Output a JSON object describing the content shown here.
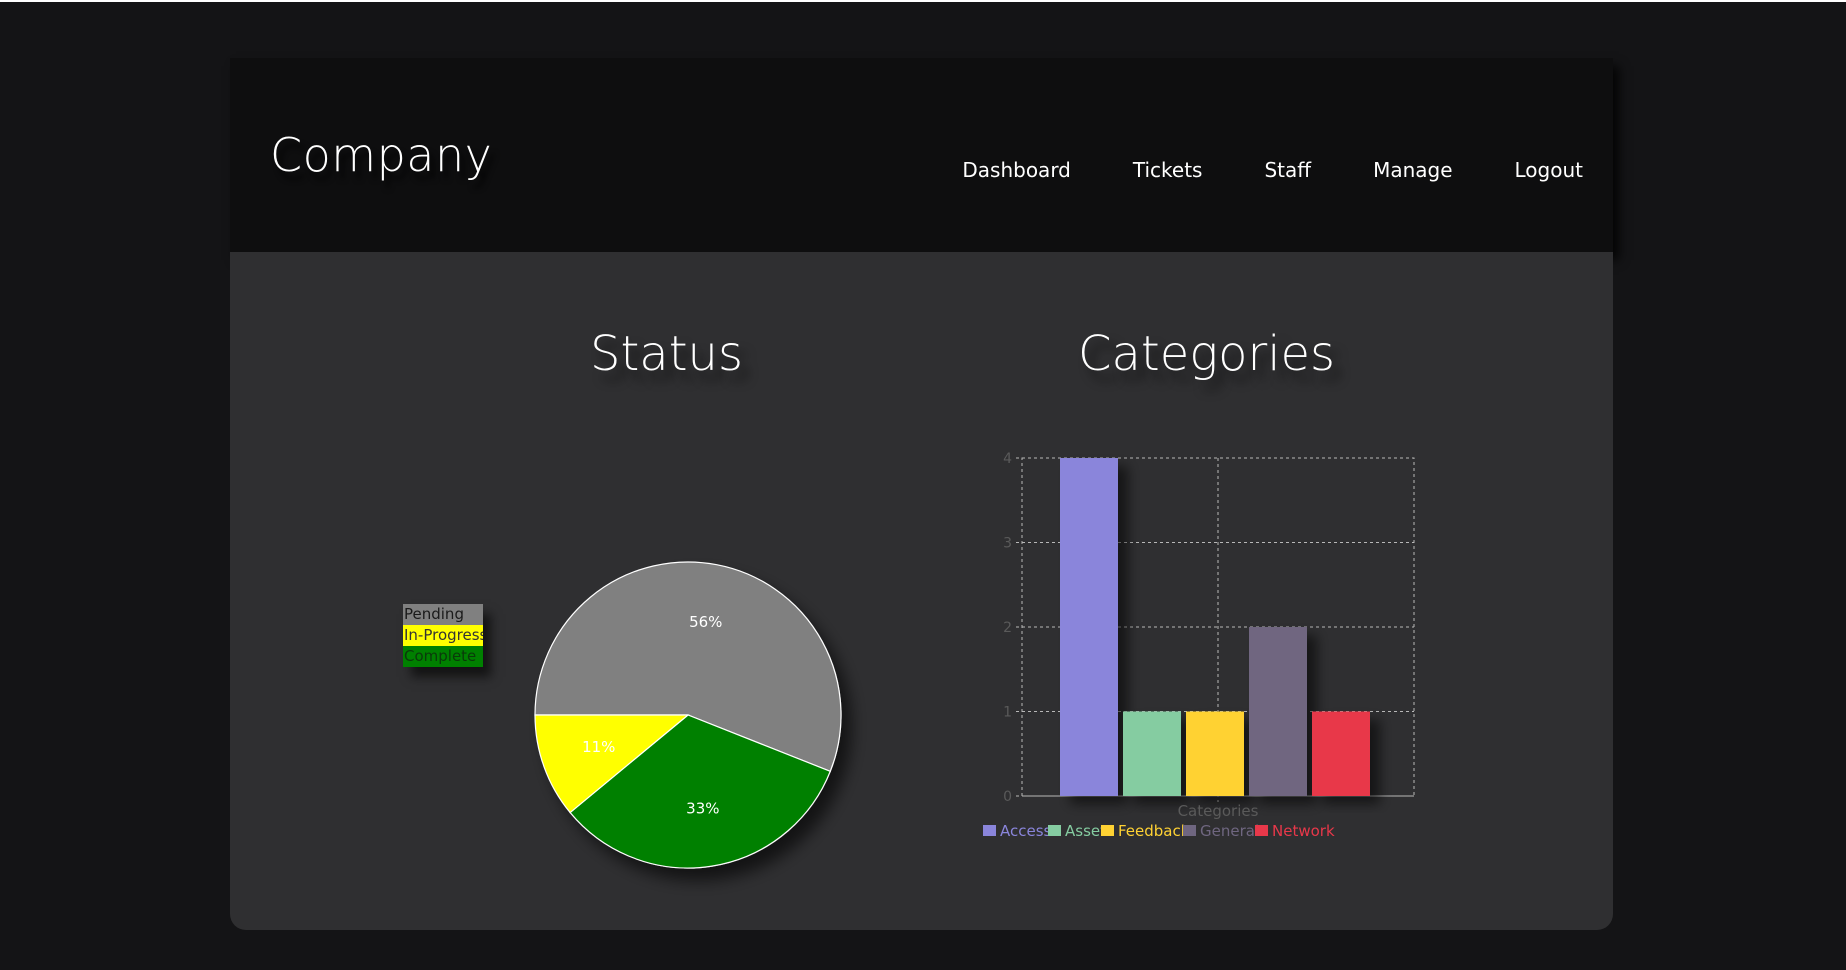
{
  "header": {
    "brand": "Company",
    "nav": [
      "Dashboard",
      "Tickets",
      "Staff",
      "Manage",
      "Logout"
    ]
  },
  "status_section": {
    "title": "Status",
    "legend": [
      {
        "label": "Pending",
        "bg": "#808080",
        "fg": "#1a1a1a"
      },
      {
        "label": "In-Progress",
        "bg": "#ffff00",
        "fg": "#333333"
      },
      {
        "label": "Complete",
        "bg": "#008000",
        "fg": "#0a3a0a"
      }
    ]
  },
  "categories_section": {
    "title": "Categories"
  },
  "colors": {
    "page_bg": "#141416",
    "header_bg": "#0e0e0f",
    "panel_bg": "#2f2f31",
    "text": "#ffffff",
    "grid": "#b8b8b8",
    "axis_text": "#5a5a5a"
  },
  "chart_data": [
    {
      "type": "pie",
      "title": "",
      "categories": [
        "Pending",
        "In-Progress",
        "Complete"
      ],
      "values": [
        56,
        11,
        33
      ],
      "labels": [
        "56%",
        "11%",
        "33%"
      ],
      "colors": [
        "#808080",
        "#ffff00",
        "#008000"
      ],
      "legend": "left"
    },
    {
      "type": "bar",
      "title": "",
      "categories": [
        "Access",
        "Asset",
        "Feedback",
        "General",
        "Network"
      ],
      "values": [
        4,
        1,
        1,
        2,
        1
      ],
      "colors": [
        "#8a85db",
        "#85cca1",
        "#ffd233",
        "#6f6680",
        "#e8384a"
      ],
      "xlabel": "Categories",
      "ylabel": "",
      "ylim": [
        0,
        4
      ],
      "yticks": [
        0,
        1,
        2,
        3,
        4
      ],
      "grid": true,
      "legend": "bottom"
    }
  ]
}
